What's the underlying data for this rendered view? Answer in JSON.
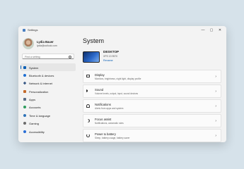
{
  "window": {
    "app_title": "Settings",
    "controls": {
      "minimize": "—",
      "maximize": "▢",
      "close": "✕"
    }
  },
  "profile": {
    "name": "Lydia Bauer",
    "email": "lydia@outlook.com"
  },
  "search": {
    "placeholder": "Find a setting"
  },
  "nav": {
    "items": [
      {
        "label": "System",
        "icon": "system-icon",
        "color": "#0a5fb5",
        "active": true
      },
      {
        "label": "Bluetooth & devices",
        "icon": "bluetooth-icon",
        "color": "#1f6fd1"
      },
      {
        "label": "Network & internet",
        "icon": "network-icon",
        "color": "#3a5a86"
      },
      {
        "label": "Personalization",
        "icon": "brush-icon",
        "color": "#c46a2b"
      },
      {
        "label": "Apps",
        "icon": "apps-icon",
        "color": "#5a6d86"
      },
      {
        "label": "Accounts",
        "icon": "accounts-icon",
        "color": "#2e9d5e"
      },
      {
        "label": "Time & language",
        "icon": "globe-icon",
        "color": "#2f73b8"
      },
      {
        "label": "Gaming",
        "icon": "gaming-icon",
        "color": "#6b6b6b"
      },
      {
        "label": "Accessibility",
        "icon": "accessibility-icon",
        "color": "#2a6fd6"
      }
    ]
  },
  "main": {
    "title": "System",
    "device": {
      "name": "DESKTOP",
      "model": "XPS 13 9570",
      "rename": "Rename"
    },
    "cards": [
      {
        "title": "Display",
        "subtitle": "Monitors, brightness, night light, display profile",
        "icon": "display-icon"
      },
      {
        "title": "Sound",
        "subtitle": "Volume levels, output, input, sound devices",
        "icon": "sound-icon"
      },
      {
        "title": "Notifications",
        "subtitle": "Alerts from apps and system",
        "icon": "notifications-icon"
      },
      {
        "title": "Focus assist",
        "subtitle": "Notifications, automatic rules",
        "icon": "focus-assist-icon"
      },
      {
        "title": "Power & battery",
        "subtitle": "Sleep, battery usage, battery saver",
        "icon": "power-icon"
      }
    ]
  }
}
